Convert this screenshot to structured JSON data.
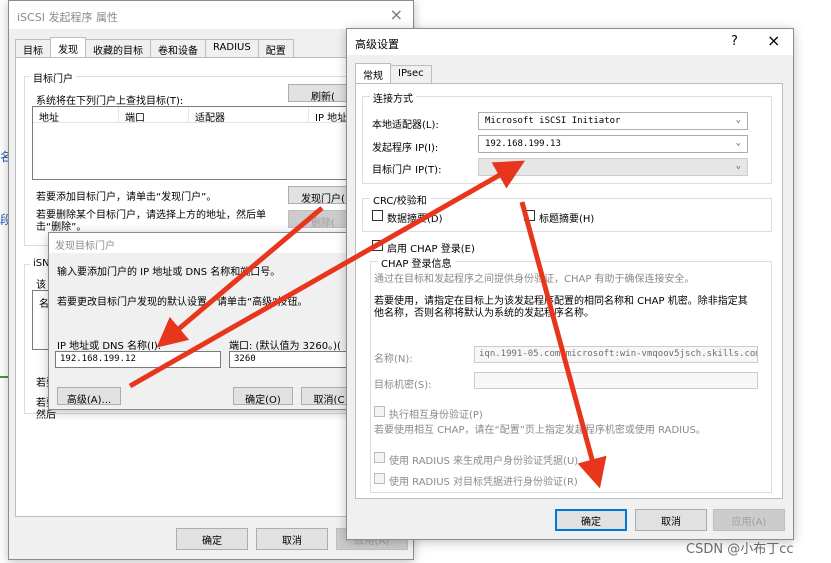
{
  "bg_window": {
    "title": "iSCSI 发起程序 属性",
    "close": "×",
    "tabs": [
      "目标",
      "发现",
      "收藏的目标",
      "卷和设备",
      "RADIUS",
      "配置"
    ],
    "group_title": "目标门户",
    "list_caption": "系统将在下列门户上查找目标(T):",
    "refresh_btn": "刷新(",
    "columns": [
      "地址",
      "端口",
      "适配器",
      "IP 地址"
    ],
    "add_hint": "若要添加目标门户，请单击“发现门户”。",
    "discover_btn": "发现门户(",
    "delete_hint": "若要删除某个目标门户，请选择上方的地址，然后单击“删除”。",
    "delete_btn": "删除(",
    "isns_title": "iSN",
    "isns_text": "该",
    "isns_col": "名",
    "frag1": "若要",
    "frag2": "若要",
    "frag3": "然后",
    "ok": "确定",
    "cancel": "取消",
    "apply": "应用(A)"
  },
  "left_edge": {
    "c1": "名",
    "c2": "段"
  },
  "discover_dialog": {
    "title": "发现目标门户",
    "line1": "输入要添加门户的 IP 地址或 DNS 名称和端口号。",
    "line2": "若要更改目标门户发现的默认设置，请单击“高级”按钮。",
    "ip_label": "IP 地址或 DNS 名称(I):",
    "ip_value": "192.168.199.12",
    "port_label": "端口: (默认值为 3260。)(",
    "port_value": "3260",
    "advanced_btn": "高级(A)...",
    "ok": "确定(O)",
    "cancel": "取消(C"
  },
  "adv_dialog": {
    "title": "高级设置",
    "help": "?",
    "close": "×",
    "tabs": [
      "常规",
      "IPsec"
    ],
    "conn_title": "连接方式",
    "local_adapter_label": "本地适配器(L):",
    "local_adapter_value": "Microsoft iSCSI Initiator",
    "initiator_ip_label": "发起程序 IP(I):",
    "initiator_ip_value": "192.168.199.13",
    "target_ip_label": "目标门户 IP(T):",
    "target_ip_value": "",
    "crc_title": "CRC/校验和",
    "data_digest": "数据摘要(D)",
    "header_digest": "标题摘要(H)",
    "enable_chap": "启用 CHAP 登录(E)",
    "chap_title": "CHAP 登录信息",
    "chap_desc": "通过在目标和发起程序之间提供身份验证，CHAP 有助于确保连接安全。",
    "chap_use": "若要使用，请指定在目标上为该发起程序配置的相同名称和 CHAP 机密。除非指定其他名称，否则名称将默认为系统的发起程序名称。",
    "name_label": "名称(N):",
    "name_value": "iqn.1991-05.com.microsoft:win-vmqoov5jsch.skills.com",
    "secret_label": "目标机密(S):",
    "secret_value": "",
    "mutual_label": "执行相互身份验证(P)",
    "mutual_desc": "若要使用相互 CHAP，请在“配置”页上指定发起程序机密或使用 RADIUS。",
    "radius1": "使用 RADIUS 来生成用户身份验证凭据(U)",
    "radius2": "使用 RADIUS 对目标凭据进行身份验证(R)",
    "ok": "确定",
    "cancel": "取消",
    "apply": "应用(A)"
  },
  "watermark": "CSDN @小布丁cc",
  "colors": {
    "arrow": "#e8361d",
    "focus": "#0078d7"
  }
}
